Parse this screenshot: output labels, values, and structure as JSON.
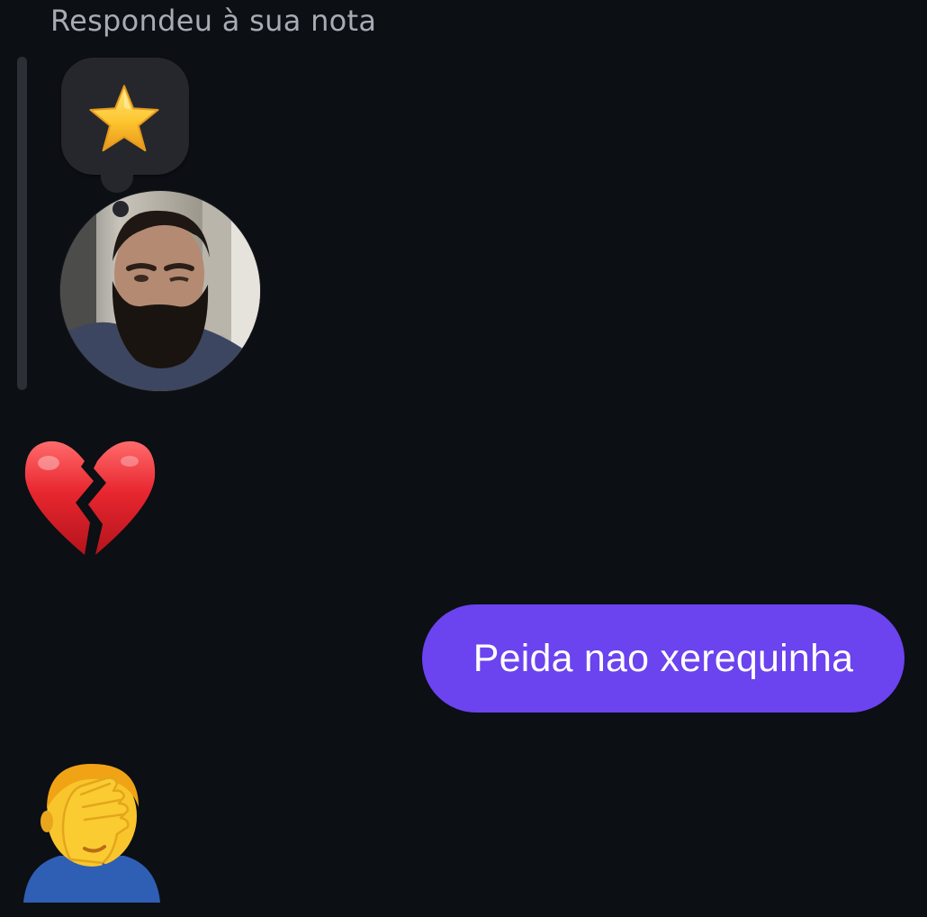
{
  "reply": {
    "header": "Respondeu à sua nota",
    "note_emoji": "star-icon"
  },
  "messages": [
    {
      "type": "emoji",
      "emoji": "broken-heart-icon"
    },
    {
      "type": "text",
      "sender": "me",
      "text": "Peida nao xerequinha"
    },
    {
      "type": "emoji",
      "emoji": "man-facepalming-icon"
    }
  ],
  "colors": {
    "background": "#0c0f14",
    "outgoing_bubble": "#6b43ef",
    "reply_header_text": "#a7abb3",
    "note_bubble": "#25272d"
  }
}
